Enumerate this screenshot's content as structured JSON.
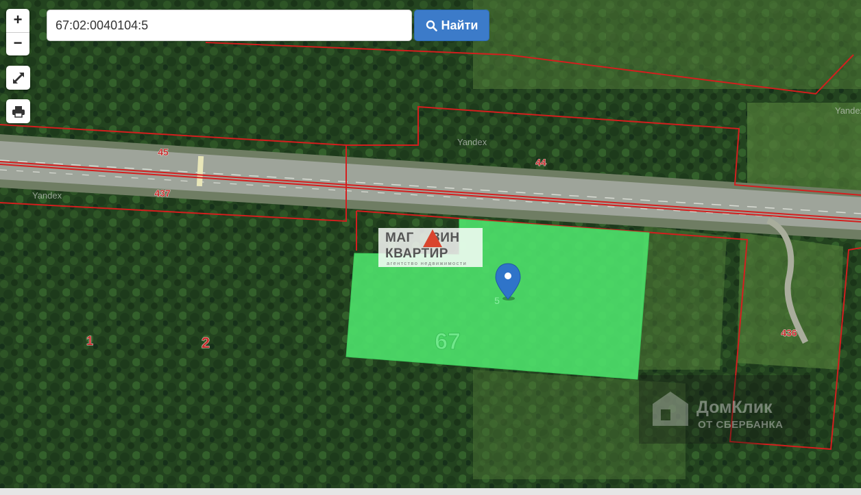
{
  "controls": {
    "zoom_in": "+",
    "zoom_out": "−",
    "fullscreen_icon": "expand-arrows",
    "print_icon": "printer"
  },
  "search": {
    "value": "67:02:0040104:5",
    "button_label": "Найти",
    "button_icon": "magnifier"
  },
  "map": {
    "parcel_labels": [
      "45",
      "437",
      "44",
      "1",
      "2",
      "67",
      "5",
      "436"
    ],
    "tile_attribution": "Yandex",
    "selected_parcel_number": "5",
    "selected_quarter_number": "67",
    "colors": {
      "parcel_boundary": "#d41e1e",
      "selected_parcel": "#4ee26c",
      "marker": "#2f74c9",
      "forest": "#22441f",
      "road": "#9ea49a"
    }
  },
  "watermarks": {
    "logo_line1": "МАГ",
    "logo_line1_end": "ЗИН",
    "logo_line2": "КВАРТИР",
    "logo_tagline": "агентство недвижимости",
    "domclick_title": "ДомКлик",
    "domclick_subtitle": "ОТ СБЕРБАНКА"
  }
}
